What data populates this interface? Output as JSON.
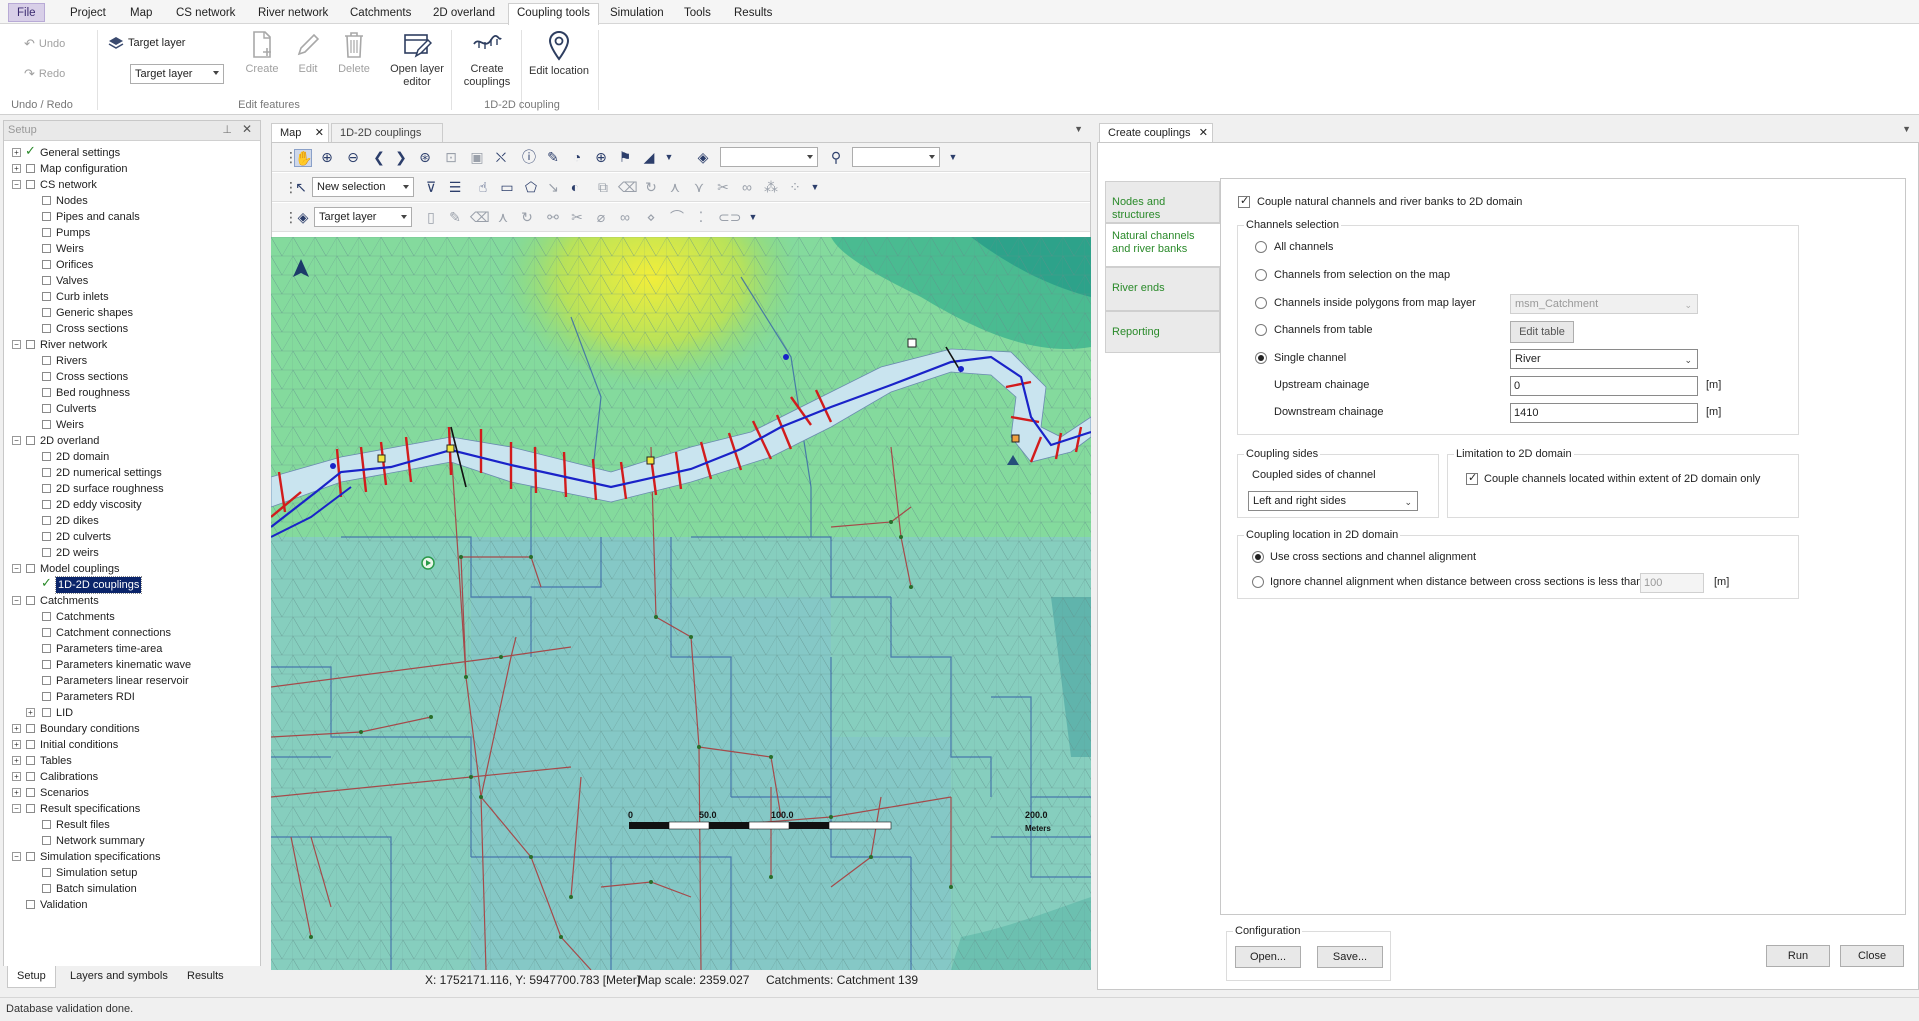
{
  "menu": {
    "items": [
      "File",
      "Project",
      "Map",
      "CS network",
      "River network",
      "Catchments",
      "2D overland",
      "Coupling tools",
      "Simulation",
      "Tools",
      "Results"
    ],
    "active": "Coupling tools"
  },
  "ribbon": {
    "undo": "Undo",
    "redo": "Redo",
    "undo_group": "Undo / Redo",
    "target_layer_label": "Target layer",
    "target_layer_value": "Target layer",
    "create": "Create",
    "edit": "Edit",
    "delete": "Delete",
    "open_layer_editor": "Open layer editor",
    "edit_features_group": "Edit features",
    "create_couplings": "Create couplings",
    "edit_location": "Edit location",
    "coupling_group": "1D-2D coupling"
  },
  "setup": {
    "title": "Setup",
    "tree": [
      {
        "label": "General settings",
        "level": 0,
        "exp": "+",
        "checked": true
      },
      {
        "label": "Map configuration",
        "level": 0,
        "exp": "+"
      },
      {
        "label": "CS network",
        "level": 0,
        "exp": "-"
      },
      {
        "label": "Nodes",
        "level": 1
      },
      {
        "label": "Pipes and canals",
        "level": 1
      },
      {
        "label": "Pumps",
        "level": 1
      },
      {
        "label": "Weirs",
        "level": 1
      },
      {
        "label": "Orifices",
        "level": 1
      },
      {
        "label": "Valves",
        "level": 1
      },
      {
        "label": "Curb inlets",
        "level": 1
      },
      {
        "label": "Generic shapes",
        "level": 1
      },
      {
        "label": "Cross sections",
        "level": 1
      },
      {
        "label": "River network",
        "level": 0,
        "exp": "-"
      },
      {
        "label": "Rivers",
        "level": 1
      },
      {
        "label": "Cross sections",
        "level": 1
      },
      {
        "label": "Bed roughness",
        "level": 1
      },
      {
        "label": "Culverts",
        "level": 1
      },
      {
        "label": "Weirs",
        "level": 1
      },
      {
        "label": "2D overland",
        "level": 0,
        "exp": "-"
      },
      {
        "label": "2D domain",
        "level": 1
      },
      {
        "label": "2D numerical settings",
        "level": 1
      },
      {
        "label": "2D surface roughness",
        "level": 1
      },
      {
        "label": "2D eddy viscosity",
        "level": 1
      },
      {
        "label": "2D dikes",
        "level": 1
      },
      {
        "label": "2D culverts",
        "level": 1
      },
      {
        "label": "2D weirs",
        "level": 1
      },
      {
        "label": "Model couplings",
        "level": 0,
        "exp": "-"
      },
      {
        "label": "1D-2D couplings",
        "level": 1,
        "checked": true,
        "selected": true
      },
      {
        "label": "Catchments",
        "level": 0,
        "exp": "-"
      },
      {
        "label": "Catchments",
        "level": 1
      },
      {
        "label": "Catchment connections",
        "level": 1
      },
      {
        "label": "Parameters time-area",
        "level": 1
      },
      {
        "label": "Parameters kinematic wave",
        "level": 1
      },
      {
        "label": "Parameters linear reservoir",
        "level": 1
      },
      {
        "label": "Parameters RDI",
        "level": 1
      },
      {
        "label": "LID",
        "level": 1,
        "exp": "+"
      },
      {
        "label": "Boundary conditions",
        "level": 0,
        "exp": "+"
      },
      {
        "label": "Initial conditions",
        "level": 0,
        "exp": "+"
      },
      {
        "label": "Tables",
        "level": 0,
        "exp": "+"
      },
      {
        "label": "Calibrations",
        "level": 0,
        "exp": "+"
      },
      {
        "label": "Scenarios",
        "level": 0,
        "exp": "+"
      },
      {
        "label": "Result specifications",
        "level": 0,
        "exp": "-"
      },
      {
        "label": "Result files",
        "level": 1
      },
      {
        "label": "Network summary",
        "level": 1
      },
      {
        "label": "Simulation specifications",
        "level": 0,
        "exp": "-"
      },
      {
        "label": "Simulation setup",
        "level": 1
      },
      {
        "label": "Batch simulation",
        "level": 1
      },
      {
        "label": "Validation",
        "level": 0
      }
    ],
    "bottom_tabs": [
      "Setup",
      "Layers and symbols",
      "Results"
    ]
  },
  "map": {
    "tabs": [
      "Map",
      "1D-2D couplings"
    ],
    "selection_combo": "New selection",
    "target_layer_combo": "Target layer",
    "scale_labels": [
      "0",
      "50.0",
      "100.0",
      "200.0"
    ],
    "scale_unit": "Meters",
    "status": {
      "coords": "X: 1752171.116, Y: 5947700.783 [Meter]",
      "scale": "Map scale: 2359.027",
      "catchment": "Catchments: Catchment 139"
    }
  },
  "panel": {
    "tab": "Create couplings",
    "vtabs": [
      "Nodes and structures",
      "Natural channels and river banks",
      "River ends",
      "Reporting"
    ],
    "couple_natural": "Couple natural channels and river banks to 2D domain",
    "channels_selection": "Channels selection",
    "opt_all": "All channels",
    "opt_selection": "Channels from selection on the map",
    "opt_polygons": "Channels inside polygons from map layer",
    "polygons_layer": "msm_Catchment",
    "opt_table": "Channels from table",
    "edit_table": "Edit table",
    "opt_single": "Single channel",
    "single_value": "River",
    "upstream_label": "Upstream chainage",
    "upstream_value": "0",
    "downstream_label": "Downstream chainage",
    "downstream_value": "1410",
    "unit_m": "[m]",
    "coupling_sides": "Coupling sides",
    "coupled_sides_label": "Coupled sides of channel",
    "coupled_sides_value": "Left and right sides",
    "limitation": "Limitation to 2D domain",
    "limitation_chk": "Couple channels located within extent of 2D domain only",
    "location": "Coupling location in 2D domain",
    "loc_use": "Use cross sections and channel alignment",
    "loc_ignore": "Ignore channel alignment when distance between cross sections is less than",
    "loc_distance": "100",
    "configuration": "Configuration",
    "open": "Open...",
    "save": "Save...",
    "run": "Run",
    "close": "Close"
  },
  "statusbar": "Database validation done."
}
